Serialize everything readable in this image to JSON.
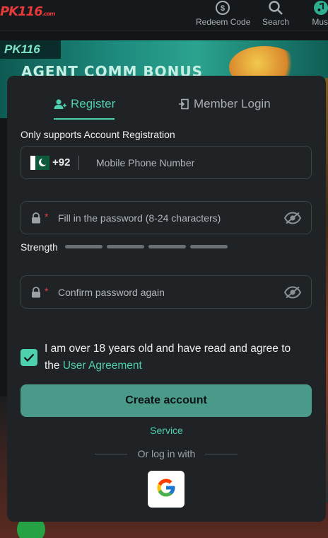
{
  "header": {
    "logo_text": "PK116",
    "logo_suffix": ".com",
    "nav": [
      {
        "label": "Redeem Code",
        "icon": "redeem-icon"
      },
      {
        "label": "Search",
        "icon": "search-icon"
      },
      {
        "label": "Musi",
        "icon": "music-icon"
      }
    ]
  },
  "banner": {
    "badge": "PK116",
    "title": "AGENT COMM BONUS"
  },
  "modal": {
    "tabs": [
      {
        "label": "Register",
        "icon": "user-add-icon",
        "active": true
      },
      {
        "label": "Member Login",
        "icon": "login-icon",
        "active": false
      }
    ],
    "note": "Only supports Account Registration",
    "phone": {
      "country_code": "+92",
      "placeholder": "Mobile Phone Number",
      "value": ""
    },
    "password": {
      "required_mark": "*",
      "placeholder": "Fill in the password (8-24 characters)",
      "value": ""
    },
    "strength": {
      "label": "Strength",
      "level": 0,
      "segments": 4
    },
    "confirm": {
      "required_mark": "*",
      "placeholder": "Confirm password again",
      "value": ""
    },
    "agreement": {
      "checked": true,
      "text": "I am over 18 years old and have read and agree to the ",
      "link": "User Agreement"
    },
    "create_button": "Create account",
    "service_link": "Service",
    "alt_login_label": "Or log in with",
    "providers": [
      {
        "name": "Google",
        "icon": "google-icon"
      }
    ]
  },
  "colors": {
    "accent": "#4ecfae",
    "button": "#4a9a89",
    "modal_bg": "#1f2326",
    "page_bg": "#121416",
    "required": "#e0424a"
  }
}
